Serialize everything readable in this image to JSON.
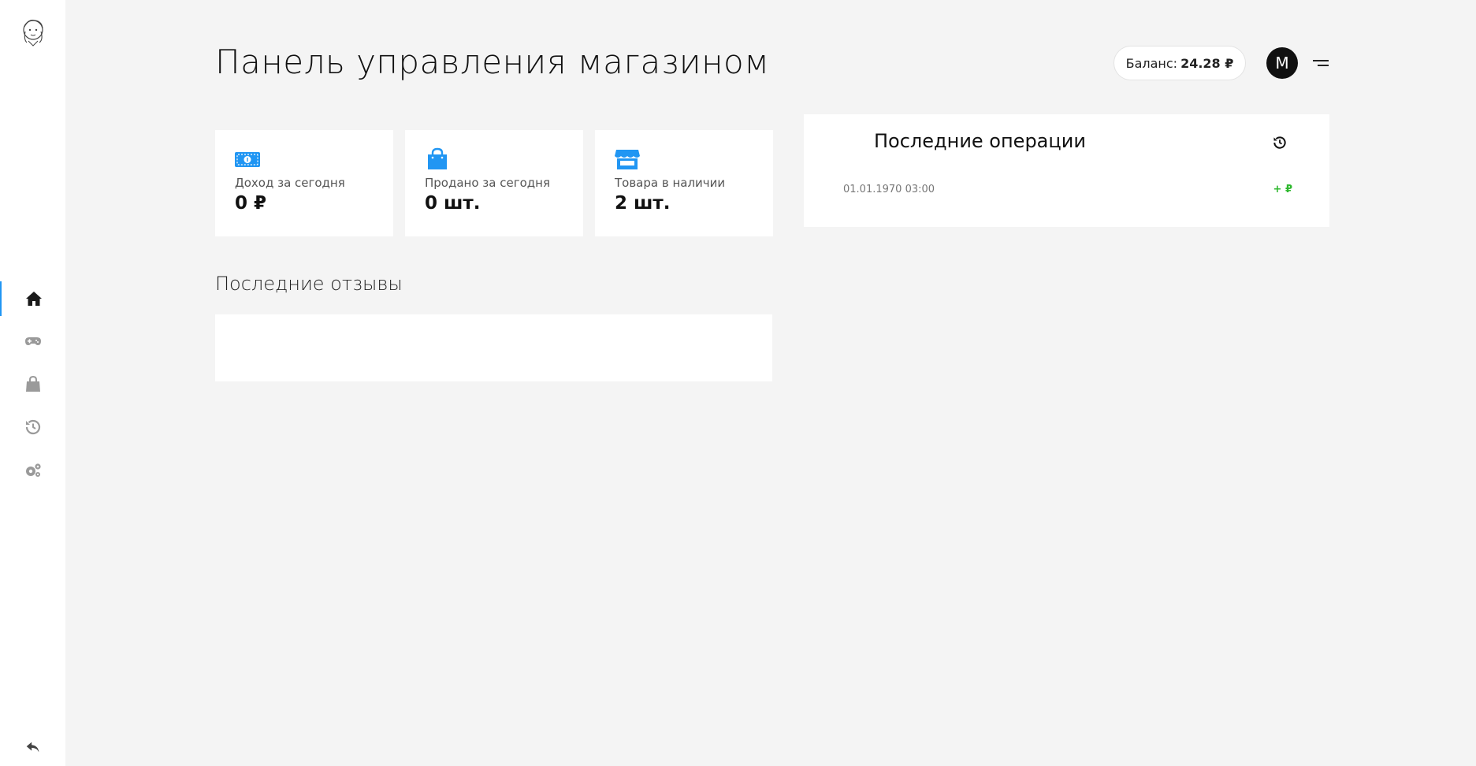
{
  "header": {
    "title": "Панель управления магазином",
    "balance_label": "Баланс:",
    "balance_value": "24.28 ₽",
    "avatar_letter": "M"
  },
  "sidebar": {
    "items": [
      {
        "icon": "home-icon",
        "active": true
      },
      {
        "icon": "gamepad-icon",
        "active": false
      },
      {
        "icon": "shopping-bag-icon",
        "active": false
      },
      {
        "icon": "history-icon",
        "active": false
      },
      {
        "icon": "gears-icon",
        "active": false
      }
    ],
    "bottom_icon": "reply-arrow-icon"
  },
  "stats": [
    {
      "icon": "money-bill-icon",
      "label": "Доход за сегодня",
      "value": "0 ₽"
    },
    {
      "icon": "shopping-bag-icon",
      "label": "Продано за сегодня",
      "value": "0 шт."
    },
    {
      "icon": "store-icon",
      "label": "Товара в наличии",
      "value": "2 шт."
    }
  ],
  "reviews": {
    "title": "Последние отзывы"
  },
  "operations": {
    "title": "Последние операции",
    "items": [
      {
        "date": "01.01.1970 03:00",
        "amount": "+ ₽"
      }
    ]
  },
  "colors": {
    "accent": "#2196f3",
    "positive": "#2eb82e",
    "background": "#f4f4f4",
    "icon_muted": "#9a9a9a"
  }
}
